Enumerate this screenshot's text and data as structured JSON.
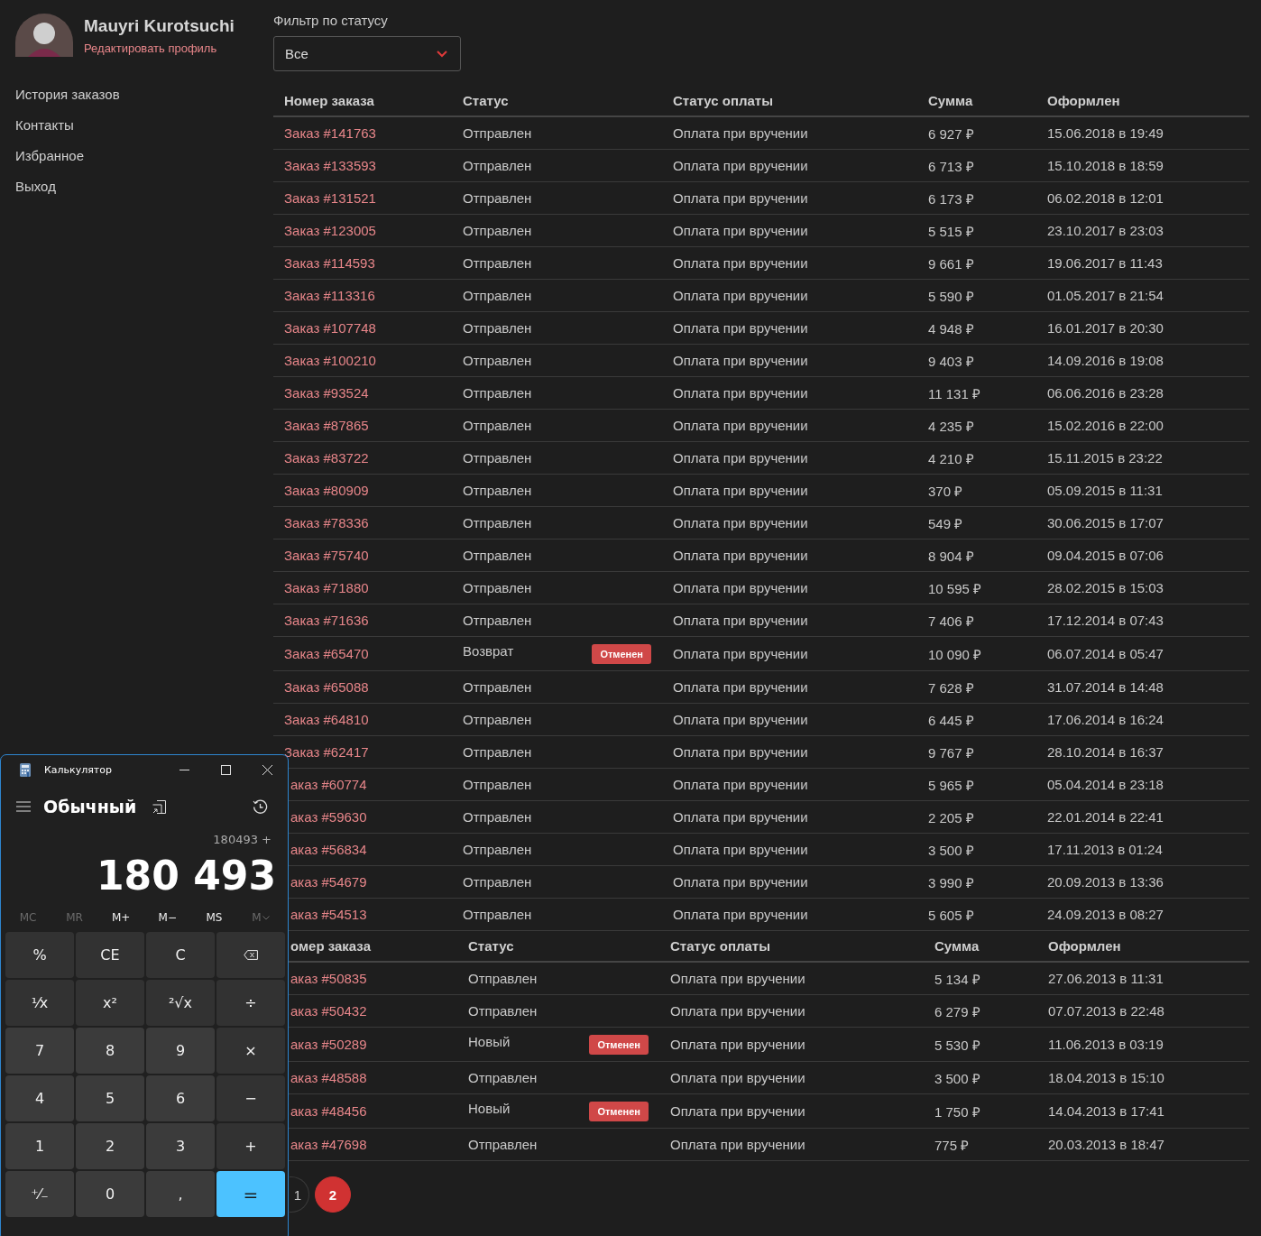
{
  "profile": {
    "name": "Mauyri Kurotsuchi",
    "edit_link": "Редактировать профиль"
  },
  "sidebar": {
    "items": [
      {
        "label": "История заказов"
      },
      {
        "label": "Контакты"
      },
      {
        "label": "Избранное"
      },
      {
        "label": "Выход"
      }
    ]
  },
  "filter": {
    "label": "Фильтр по статусу",
    "value": "Все"
  },
  "tables": [
    {
      "columns": [
        "Номер заказа",
        "Статус",
        "Статус оплаты",
        "Сумма",
        "Оформлен"
      ],
      "rows": [
        {
          "order": "Заказ #141763",
          "status": "Отправлен",
          "payment": "Оплата при вручении",
          "sum": "6 927 ₽",
          "date": "15.06.2018 в 19:49"
        },
        {
          "order": "Заказ #133593",
          "status": "Отправлен",
          "payment": "Оплата при вручении",
          "sum": "6 713 ₽",
          "date": "15.10.2018 в 18:59"
        },
        {
          "order": "Заказ #131521",
          "status": "Отправлен",
          "payment": "Оплата при вручении",
          "sum": "6 173 ₽",
          "date": "06.02.2018 в 12:01"
        },
        {
          "order": "Заказ #123005",
          "status": "Отправлен",
          "payment": "Оплата при вручении",
          "sum": "5 515 ₽",
          "date": "23.10.2017 в 23:03"
        },
        {
          "order": "Заказ #114593",
          "status": "Отправлен",
          "payment": "Оплата при вручении",
          "sum": "9 661 ₽",
          "date": "19.06.2017 в 11:43"
        },
        {
          "order": "Заказ #113316",
          "status": "Отправлен",
          "payment": "Оплата при вручении",
          "sum": "5 590 ₽",
          "date": "01.05.2017 в 21:54"
        },
        {
          "order": "Заказ #107748",
          "status": "Отправлен",
          "payment": "Оплата при вручении",
          "sum": "4 948 ₽",
          "date": "16.01.2017 в 20:30"
        },
        {
          "order": "Заказ #100210",
          "status": "Отправлен",
          "payment": "Оплата при вручении",
          "sum": "9 403 ₽",
          "date": "14.09.2016 в 19:08"
        },
        {
          "order": "Заказ #93524",
          "status": "Отправлен",
          "payment": "Оплата при вручении",
          "sum": "11 131 ₽",
          "date": "06.06.2016 в 23:28"
        },
        {
          "order": "Заказ #87865",
          "status": "Отправлен",
          "payment": "Оплата при вручении",
          "sum": "4 235 ₽",
          "date": "15.02.2016 в 22:00"
        },
        {
          "order": "Заказ #83722",
          "status": "Отправлен",
          "payment": "Оплата при вручении",
          "sum": "4 210 ₽",
          "date": "15.11.2015 в 23:22"
        },
        {
          "order": "Заказ #80909",
          "status": "Отправлен",
          "payment": "Оплата при вручении",
          "sum": "370 ₽",
          "date": "05.09.2015 в 11:31"
        },
        {
          "order": "Заказ #78336",
          "status": "Отправлен",
          "payment": "Оплата при вручении",
          "sum": "549 ₽",
          "date": "30.06.2015 в 17:07"
        },
        {
          "order": "Заказ #75740",
          "status": "Отправлен",
          "payment": "Оплата при вручении",
          "sum": "8 904 ₽",
          "date": "09.04.2015 в 07:06"
        },
        {
          "order": "Заказ #71880",
          "status": "Отправлен",
          "payment": "Оплата при вручении",
          "sum": "10 595 ₽",
          "date": "28.02.2015 в 15:03"
        },
        {
          "order": "Заказ #71636",
          "status": "Отправлен",
          "payment": "Оплата при вручении",
          "sum": "7 406 ₽",
          "date": "17.12.2014 в 07:43"
        },
        {
          "order": "Заказ #65470",
          "status": "Возврат",
          "badge": "Отменен",
          "payment": "Оплата при вручении",
          "sum": "10 090 ₽",
          "date": "06.07.2014 в 05:47"
        },
        {
          "order": "Заказ #65088",
          "status": "Отправлен",
          "payment": "Оплата при вручении",
          "sum": "7 628 ₽",
          "date": "31.07.2014 в 14:48"
        },
        {
          "order": "Заказ #64810",
          "status": "Отправлен",
          "payment": "Оплата при вручении",
          "sum": "6 445 ₽",
          "date": "17.06.2014 в 16:24"
        },
        {
          "order": "Заказ #62417",
          "status": "Отправлен",
          "payment": "Оплата при вручении",
          "sum": "9 767 ₽",
          "date": "28.10.2014 в 16:37"
        },
        {
          "order": "аказ #60774",
          "status": "Отправлен",
          "payment": "Оплата при вручении",
          "sum": "5 965 ₽",
          "date": "05.04.2014 в 23:18"
        },
        {
          "order": "аказ #59630",
          "status": "Отправлен",
          "payment": "Оплата при вручении",
          "sum": "2 205 ₽",
          "date": "22.01.2014 в 22:41"
        },
        {
          "order": "аказ #56834",
          "status": "Отправлен",
          "payment": "Оплата при вручении",
          "sum": "3 500 ₽",
          "date": "17.11.2013 в 01:24"
        },
        {
          "order": "аказ #54679",
          "status": "Отправлен",
          "payment": "Оплата при вручении",
          "sum": "3 990 ₽",
          "date": "20.09.2013 в 13:36"
        },
        {
          "order": "аказ #54513",
          "status": "Отправлен",
          "payment": "Оплата при вручении",
          "sum": "5 605 ₽",
          "date": "24.09.2013 в 08:27"
        }
      ]
    },
    {
      "columns": [
        "омер заказа",
        "Статус",
        "Статус оплаты",
        "Сумма",
        "Оформлен"
      ],
      "rows": [
        {
          "order": "аказ #50835",
          "status": "Отправлен",
          "payment": "Оплата при вручении",
          "sum": "5 134 ₽",
          "date": "27.06.2013 в 11:31"
        },
        {
          "order": "аказ #50432",
          "status": "Отправлен",
          "payment": "Оплата при вручении",
          "sum": "6 279 ₽",
          "date": "07.07.2013 в 22:48"
        },
        {
          "order": "аказ #50289",
          "status": "Новый",
          "badge": "Отменен",
          "payment": "Оплата при вручении",
          "sum": "5 530 ₽",
          "date": "11.06.2013 в 03:19"
        },
        {
          "order": "аказ #48588",
          "status": "Отправлен",
          "payment": "Оплата при вручении",
          "sum": "3 500 ₽",
          "date": "18.04.2013 в 15:10"
        },
        {
          "order": "аказ #48456",
          "status": "Новый",
          "badge": "Отменен",
          "payment": "Оплата при вручении",
          "sum": "1 750 ₽",
          "date": "14.04.2013 в 17:41"
        },
        {
          "order": "аказ #47698",
          "status": "Отправлен",
          "payment": "Оплата при вручении",
          "sum": "775 ₽",
          "date": "20.03.2013 в 18:47"
        }
      ]
    }
  ],
  "pagination": [
    {
      "label": "1",
      "selected": false
    },
    {
      "label": "2",
      "selected": true
    }
  ],
  "calculator": {
    "title": "Калькулятор",
    "mode": "Обычный",
    "expression": "180493 +",
    "display": "180 493",
    "memory": [
      {
        "label": "MC",
        "disabled": true
      },
      {
        "label": "MR",
        "disabled": true
      },
      {
        "label": "M+",
        "disabled": false
      },
      {
        "label": "M−",
        "disabled": false
      },
      {
        "label": "MS",
        "disabled": false
      },
      {
        "label": "M",
        "disabled": true,
        "kind": "list"
      }
    ],
    "keys": [
      {
        "label": "%",
        "kind": "func"
      },
      {
        "label": "CE",
        "kind": "func"
      },
      {
        "label": "C",
        "kind": "func"
      },
      {
        "kind": "backspace"
      },
      {
        "label": "¹⁄x",
        "kind": "func"
      },
      {
        "label": "x²",
        "kind": "func"
      },
      {
        "label": "²√x",
        "kind": "func"
      },
      {
        "label": "÷",
        "kind": "op"
      },
      {
        "label": "7",
        "kind": "digit"
      },
      {
        "label": "8",
        "kind": "digit"
      },
      {
        "label": "9",
        "kind": "digit"
      },
      {
        "label": "×",
        "kind": "op"
      },
      {
        "label": "4",
        "kind": "digit"
      },
      {
        "label": "5",
        "kind": "digit"
      },
      {
        "label": "6",
        "kind": "digit"
      },
      {
        "label": "−",
        "kind": "op"
      },
      {
        "label": "1",
        "kind": "digit"
      },
      {
        "label": "2",
        "kind": "digit"
      },
      {
        "label": "3",
        "kind": "digit"
      },
      {
        "label": "+",
        "kind": "op"
      },
      {
        "label": "⁺⁄₋",
        "kind": "digit"
      },
      {
        "label": "0",
        "kind": "digit"
      },
      {
        "label": ",",
        "kind": "digit"
      },
      {
        "label": "=",
        "kind": "equals"
      }
    ]
  }
}
